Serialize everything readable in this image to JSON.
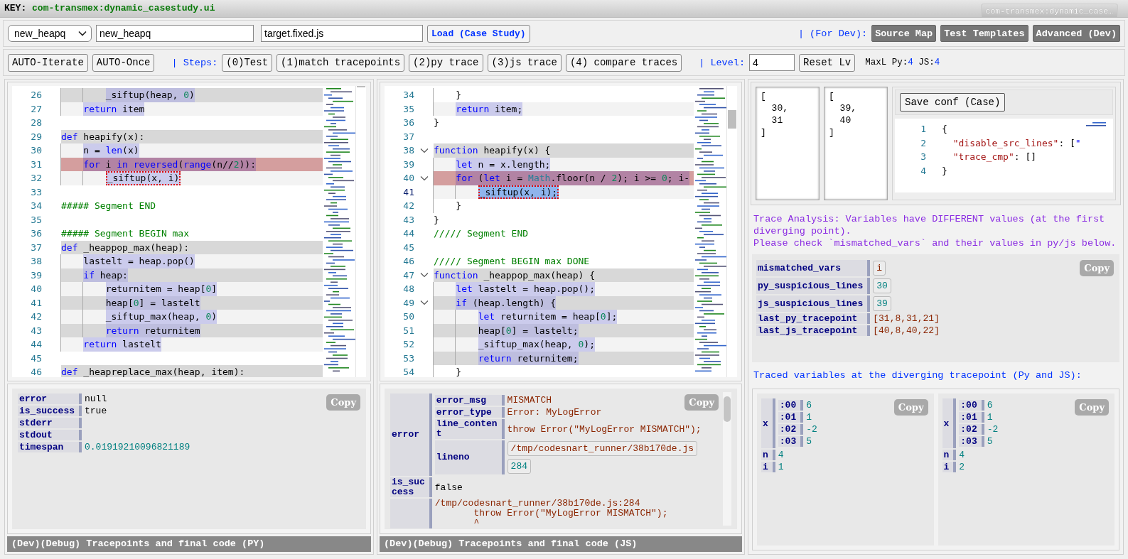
{
  "key_bar": {
    "label": "KEY:",
    "value": "com-transmex:dynamic_casestudy.ui",
    "tab": "com-transmex:dynamic_case…"
  },
  "toolbar": {
    "case_select": "new_heapq",
    "name_field": "new_heapq",
    "file_field": "target.fixed.js",
    "load_button": "Load (Case Study)",
    "dev_label": "| (For Dev):",
    "dev_buttons": [
      "Source Map",
      "Test Templates",
      "Advanced (Dev)"
    ]
  },
  "steps_bar": {
    "auto_buttons": [
      "AUTO-Iterate",
      "AUTO-Once"
    ],
    "steps_label": "| Steps:",
    "step_buttons": [
      "(0)Test",
      "(1)match tracepoints",
      "(2)py trace",
      "(3)js trace",
      "(4) compare traces"
    ],
    "level_label": "| Level:",
    "level_value": "4",
    "reset_button": "Reset Lv",
    "maxl": {
      "py_label": "MaxL Py:",
      "py": "4",
      "js_label": "JS:",
      "js": "4"
    }
  },
  "py_panel": {
    "editor": {
      "lines": [
        {
          "no": "26",
          "kind": "dark",
          "covered": true,
          "marked": false,
          "tokens": [
            {
              "kind": "tx",
              "text": "        _siftup(heap, "
            },
            {
              "kind": "num",
              "text": "0"
            },
            {
              "kind": "tx",
              "text": ")"
            }
          ]
        },
        {
          "no": "27",
          "kind": "light",
          "covered": true,
          "marked": false,
          "tokens": [
            {
              "kind": "kw",
              "text": "    return"
            },
            {
              "kind": "tx",
              "text": " item"
            }
          ]
        },
        {
          "no": "28",
          "kind": "plain"
        },
        {
          "no": "29",
          "kind": "dark",
          "covered": false,
          "marked": false,
          "tokens": [
            {
              "kind": "kw",
              "text": "def"
            },
            {
              "kind": "tx",
              "text": " heapify(x):"
            }
          ]
        },
        {
          "no": "30",
          "kind": "light",
          "covered": true,
          "marked": false,
          "tokens": [
            {
              "kind": "tx",
              "text": "    n = "
            },
            {
              "kind": "kw",
              "text": "len"
            },
            {
              "kind": "tx",
              "text": "(x)"
            }
          ]
        },
        {
          "no": "31",
          "kind": "error",
          "covered": true,
          "marked": false,
          "tokens": [
            {
              "kind": "kw",
              "text": "    for"
            },
            {
              "kind": "tx",
              "text": " i "
            },
            {
              "kind": "kw",
              "text": "in reversed"
            },
            {
              "kind": "tx",
              "text": "("
            },
            {
              "kind": "kw",
              "text": "range"
            },
            {
              "kind": "tx",
              "text": "(n//"
            },
            {
              "kind": "num",
              "text": "2"
            },
            {
              "kind": "tx",
              "text": ")):"
            }
          ]
        },
        {
          "no": "32",
          "kind": "light",
          "covered": true,
          "marked": true,
          "tokens": [
            {
              "kind": "tx",
              "text": "        _siftup(x, i)"
            }
          ]
        },
        {
          "no": "33",
          "kind": "plain"
        },
        {
          "no": "34",
          "kind": "plain",
          "covered": false,
          "marked": false,
          "tokens": [
            {
              "kind": "cm",
              "text": "##### Segment END"
            }
          ]
        },
        {
          "no": "35",
          "kind": "plain"
        },
        {
          "no": "36",
          "kind": "plain",
          "covered": false,
          "marked": false,
          "tokens": [
            {
              "kind": "cm",
              "text": "##### Segment BEGIN max"
            }
          ]
        },
        {
          "no": "37",
          "kind": "dark",
          "covered": false,
          "marked": false,
          "tokens": [
            {
              "kind": "kw",
              "text": "def"
            },
            {
              "kind": "tx",
              "text": " _heappop_max(heap):"
            }
          ]
        },
        {
          "no": "38",
          "kind": "light",
          "covered": true,
          "marked": false,
          "tokens": [
            {
              "kind": "tx",
              "text": "    lastelt = heap.pop()"
            }
          ]
        },
        {
          "no": "39",
          "kind": "dark",
          "covered": true,
          "marked": false,
          "tokens": [
            {
              "kind": "kw",
              "text": "    if"
            },
            {
              "kind": "tx",
              "text": " heap:"
            }
          ]
        },
        {
          "no": "40",
          "kind": "light",
          "covered": true,
          "marked": false,
          "tokens": [
            {
              "kind": "tx",
              "text": "        returnitem = heap["
            },
            {
              "kind": "num",
              "text": "0"
            },
            {
              "kind": "tx",
              "text": "]"
            }
          ]
        },
        {
          "no": "41",
          "kind": "dark",
          "covered": true,
          "marked": false,
          "tokens": [
            {
              "kind": "tx",
              "text": "        heap["
            },
            {
              "kind": "num",
              "text": "0"
            },
            {
              "kind": "tx",
              "text": "] = lastelt"
            }
          ]
        },
        {
          "no": "42",
          "kind": "light",
          "covered": true,
          "marked": false,
          "tokens": [
            {
              "kind": "tx",
              "text": "        _siftup_max(heap, "
            },
            {
              "kind": "num",
              "text": "0"
            },
            {
              "kind": "tx",
              "text": ")"
            }
          ]
        },
        {
          "no": "43",
          "kind": "dark",
          "covered": true,
          "marked": false,
          "tokens": [
            {
              "kind": "kw",
              "text": "        return"
            },
            {
              "kind": "tx",
              "text": " returnitem"
            }
          ]
        },
        {
          "no": "44",
          "kind": "light",
          "covered": true,
          "marked": false,
          "tokens": [
            {
              "kind": "kw",
              "text": "    return"
            },
            {
              "kind": "tx",
              "text": " lastelt"
            }
          ]
        },
        {
          "no": "45",
          "kind": "plain"
        },
        {
          "no": "46",
          "kind": "dark",
          "covered": false,
          "marked": false,
          "tokens": [
            {
              "kind": "kw",
              "text": "def"
            },
            {
              "kind": "tx",
              "text": " _heapreplace_max(heap, item):"
            }
          ]
        }
      ]
    },
    "result": {
      "copy": "Copy",
      "rows": [
        {
          "key": "error",
          "value": "null",
          "kind": "plain"
        },
        {
          "key": "is_success",
          "value": "true",
          "kind": "plain"
        },
        {
          "key": "stderr"
        },
        {
          "key": "stdout"
        },
        {
          "key": "timespan",
          "value": "0.01919210096821189",
          "kind": "num"
        }
      ]
    },
    "footer": "(Dev)(Debug) Tracepoints and final code (PY)"
  },
  "js_panel": {
    "editor": {
      "lines": [
        {
          "no": "34",
          "kind": "plain",
          "covered": false,
          "marked": false,
          "selected": false,
          "foldable": false,
          "tokens": [
            {
              "kind": "tx",
              "text": "    }"
            }
          ]
        },
        {
          "no": "35",
          "kind": "light",
          "covered": true,
          "marked": false,
          "selected": false,
          "foldable": false,
          "tokens": [
            {
              "kind": "kw",
              "text": "    return"
            },
            {
              "kind": "tx",
              "text": " item;"
            }
          ]
        },
        {
          "no": "36",
          "kind": "plain",
          "covered": false,
          "marked": false,
          "selected": false,
          "foldable": false,
          "tokens": [
            {
              "kind": "tx",
              "text": "}"
            }
          ]
        },
        {
          "no": "37",
          "kind": "plain",
          "selected": false,
          "foldable": false
        },
        {
          "no": "38",
          "kind": "dark",
          "covered": false,
          "marked": false,
          "selected": false,
          "foldable": true,
          "tokens": [
            {
              "kind": "kw",
              "text": "function"
            },
            {
              "kind": "tx",
              "text": " heapify(x) {"
            }
          ]
        },
        {
          "no": "39",
          "kind": "light",
          "covered": true,
          "marked": false,
          "selected": false,
          "foldable": false,
          "tokens": [
            {
              "kind": "kw",
              "text": "    let"
            },
            {
              "kind": "tx",
              "text": " n = x.length;"
            }
          ]
        },
        {
          "no": "40",
          "kind": "error",
          "covered": true,
          "marked": false,
          "selected": false,
          "foldable": true,
          "tokens": [
            {
              "kind": "kw",
              "text": "    for"
            },
            {
              "kind": "tx",
              "text": " ("
            },
            {
              "kind": "kw",
              "text": "let"
            },
            {
              "kind": "tx",
              "text": " i = "
            },
            {
              "kind": "cls",
              "text": "Math"
            },
            {
              "kind": "tx",
              "text": ".floor(n / "
            },
            {
              "kind": "num",
              "text": "2"
            },
            {
              "kind": "tx",
              "text": "); i >= "
            },
            {
              "kind": "num",
              "text": "0"
            },
            {
              "kind": "tx",
              "text": "; i-"
            }
          ]
        },
        {
          "no": "41",
          "kind": "light",
          "covered": false,
          "marked": true,
          "selected": true,
          "foldable": false,
          "tokens": [
            {
              "kind": "tx",
              "text": "        _siftup(x, i);"
            }
          ]
        },
        {
          "no": "42",
          "kind": "plain",
          "covered": false,
          "marked": false,
          "selected": false,
          "foldable": false,
          "tokens": [
            {
              "kind": "tx",
              "text": "    }"
            }
          ]
        },
        {
          "no": "43",
          "kind": "plain",
          "covered": false,
          "marked": false,
          "selected": false,
          "foldable": false,
          "tokens": [
            {
              "kind": "tx",
              "text": "}"
            }
          ]
        },
        {
          "no": "44",
          "kind": "plain",
          "covered": false,
          "marked": false,
          "selected": false,
          "foldable": false,
          "tokens": [
            {
              "kind": "cm",
              "text": "///// Segment END"
            }
          ]
        },
        {
          "no": "45",
          "kind": "plain",
          "selected": false,
          "foldable": false
        },
        {
          "no": "46",
          "kind": "plain",
          "covered": false,
          "marked": false,
          "selected": false,
          "foldable": false,
          "tokens": [
            {
              "kind": "cm",
              "text": "///// Segment BEGIN max DONE"
            }
          ]
        },
        {
          "no": "47",
          "kind": "dark",
          "covered": false,
          "marked": false,
          "selected": false,
          "foldable": true,
          "tokens": [
            {
              "kind": "kw",
              "text": "function"
            },
            {
              "kind": "tx",
              "text": " _heappop_max(heap) {"
            }
          ]
        },
        {
          "no": "48",
          "kind": "light",
          "covered": true,
          "marked": false,
          "selected": false,
          "foldable": false,
          "tokens": [
            {
              "kind": "kw",
              "text": "    let"
            },
            {
              "kind": "tx",
              "text": " lastelt = heap.pop();"
            }
          ]
        },
        {
          "no": "49",
          "kind": "dark",
          "covered": true,
          "marked": false,
          "selected": false,
          "foldable": true,
          "tokens": [
            {
              "kind": "kw",
              "text": "    if"
            },
            {
              "kind": "tx",
              "text": " (heap.length) {"
            }
          ]
        },
        {
          "no": "50",
          "kind": "light",
          "covered": true,
          "marked": false,
          "selected": false,
          "foldable": false,
          "tokens": [
            {
              "kind": "kw",
              "text": "        let"
            },
            {
              "kind": "tx",
              "text": " returnitem = heap["
            },
            {
              "kind": "num",
              "text": "0"
            },
            {
              "kind": "tx",
              "text": "];"
            }
          ]
        },
        {
          "no": "51",
          "kind": "dark",
          "covered": true,
          "marked": false,
          "selected": false,
          "foldable": false,
          "tokens": [
            {
              "kind": "tx",
              "text": "        heap["
            },
            {
              "kind": "num",
              "text": "0"
            },
            {
              "kind": "tx",
              "text": "] = lastelt;"
            }
          ]
        },
        {
          "no": "52",
          "kind": "light",
          "covered": true,
          "marked": false,
          "selected": false,
          "foldable": false,
          "tokens": [
            {
              "kind": "tx",
              "text": "        _siftup_max(heap, "
            },
            {
              "kind": "num",
              "text": "0"
            },
            {
              "kind": "tx",
              "text": ");"
            }
          ]
        },
        {
          "no": "53",
          "kind": "dark",
          "covered": true,
          "marked": false,
          "selected": false,
          "foldable": false,
          "tokens": [
            {
              "kind": "kw",
              "text": "        return"
            },
            {
              "kind": "tx",
              "text": " returnitem;"
            }
          ]
        },
        {
          "no": "54",
          "kind": "plain",
          "covered": false,
          "marked": false,
          "selected": false,
          "foldable": false,
          "tokens": [
            {
              "kind": "tx",
              "text": "    }"
            }
          ]
        }
      ]
    },
    "result": {
      "copy": "Copy",
      "rows": [
        {
          "key": "error",
          "children": [
            {
              "key": "error_msg",
              "value": "MISMATCH",
              "kind": "str"
            },
            {
              "key": "error_type",
              "value": "Error: MyLogError",
              "kind": "str"
            },
            {
              "key": "line_content",
              "value": "throw Error(\"MyLogError MISMATCH\");",
              "kind": "str"
            },
            {
              "key": "lineno",
              "chips": [
                {
                  "text": "/tmp/codesnart_runner/38b170de.js",
                  "kind": "str"
                },
                {
                  "text": "284",
                  "kind": "num"
                }
              ]
            }
          ]
        },
        {
          "key": "is_success",
          "value": "false",
          "kind": "plain"
        },
        {
          "value": "/tmp/codesnart_runner/38b170de.js:284\n       throw Error(\"MyLogError MISMATCH\");\n       ^",
          "kind": "str"
        }
      ]
    },
    "footer": "(Dev)(Debug) Tracepoints and final code (JS)"
  },
  "right_panel": {
    "py_lines_box": "[\n  30,\n  31\n]",
    "js_lines_box": "[\n  39,\n  40\n]",
    "save_button": "Save conf (Case)",
    "conf_editor": {
      "lines": [
        {
          "no": "1",
          "tokens": [
            {
              "kind": "tx",
              "text": "{"
            }
          ]
        },
        {
          "no": "2",
          "tokens": [
            {
              "kind": "str",
              "text": "  \"disable_src_lines\""
            },
            {
              "kind": "tx",
              "text": ": ["
            },
            {
              "kind": "kw",
              "text": "\""
            }
          ]
        },
        {
          "no": "3",
          "tokens": [
            {
              "kind": "str",
              "text": "  \"trace_cmp\""
            },
            {
              "kind": "tx",
              "text": ": []"
            }
          ]
        },
        {
          "no": "4",
          "tokens": [
            {
              "kind": "tx",
              "text": "}"
            }
          ]
        }
      ]
    },
    "analysis": [
      "Trace Analysis: Variables have DIFFERENT values (at the first diverging point).",
      "Please check `mismatched_vars` and their values in py/js below."
    ],
    "diff": {
      "copy": "Copy",
      "rows": [
        {
          "key": "mismatched_vars",
          "chips": [
            {
              "text": "i",
              "kind": "str"
            }
          ]
        },
        {
          "key": "py_suspicious_lines",
          "chips": [
            {
              "text": "30",
              "kind": "num"
            }
          ]
        },
        {
          "key": "js_suspicious_lines",
          "chips": [
            {
              "text": "39",
              "kind": "num"
            }
          ]
        },
        {
          "key": "last_py_tracepoint",
          "value": "[31,8,31,21]",
          "kind": "str"
        },
        {
          "key": "last_js_tracepoint",
          "value": "[40,8,40,22]",
          "kind": "str"
        }
      ]
    },
    "traced_heading": "Traced variables at the diverging tracepoint (Py and JS):",
    "var_panels": [
      {
        "copy": "Copy",
        "rows": [
          {
            "key": "x",
            "children": [
              {
                "key": ":00",
                "value": "6",
                "kind": "num"
              },
              {
                "key": ":01",
                "value": "1",
                "kind": "num"
              },
              {
                "key": ":02",
                "value": "-2",
                "kind": "num"
              },
              {
                "key": ":03",
                "value": "5",
                "kind": "num"
              }
            ]
          },
          {
            "key": "n",
            "value": "4",
            "kind": "num"
          },
          {
            "key": "i",
            "value": "1",
            "kind": "num"
          }
        ]
      },
      {
        "copy": "Copy",
        "rows": [
          {
            "key": "x",
            "children": [
              {
                "key": ":00",
                "value": "6",
                "kind": "num"
              },
              {
                "key": ":01",
                "value": "1",
                "kind": "num"
              },
              {
                "key": ":02",
                "value": "-2",
                "kind": "num"
              },
              {
                "key": ":03",
                "value": "5",
                "kind": "num"
              }
            ]
          },
          {
            "key": "n",
            "value": "4",
            "kind": "num"
          },
          {
            "key": "i",
            "value": "2",
            "kind": "num"
          }
        ]
      }
    ]
  }
}
